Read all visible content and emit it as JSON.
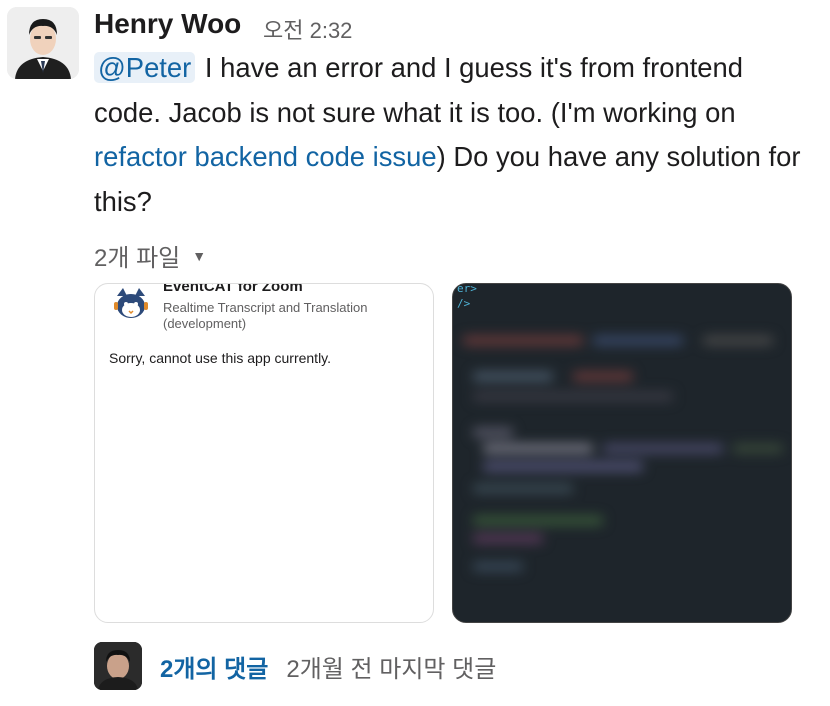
{
  "message": {
    "sender": "Henry Woo",
    "time": "오전 2:32",
    "mention": "@Peter",
    "text_before_link": "I have an error and I guess it's from frontend code. Jacob is not sure what it is too. (I'm working on ",
    "link_text": "refactor backend code issue",
    "text_after_link": ") Do you have any solution for this?"
  },
  "files": {
    "toggle_label": "2개 파일",
    "items": [
      {
        "app_title": "EventCAT for Zoom",
        "app_subtitle": "Realtime Transcript and Translation (development)",
        "note": "Sorry, cannot use this app currently."
      },
      {
        "code_tag_top": "er>",
        "code_tag_second": "/>"
      }
    ]
  },
  "replies": {
    "count_label": "2개의 댓글",
    "meta": "2개월 전 마지막 댓글"
  },
  "colors": {
    "link": "#1264a3",
    "mention_bg": "#e8f0f8",
    "muted": "#616061",
    "code_bg": "#1e252b"
  }
}
